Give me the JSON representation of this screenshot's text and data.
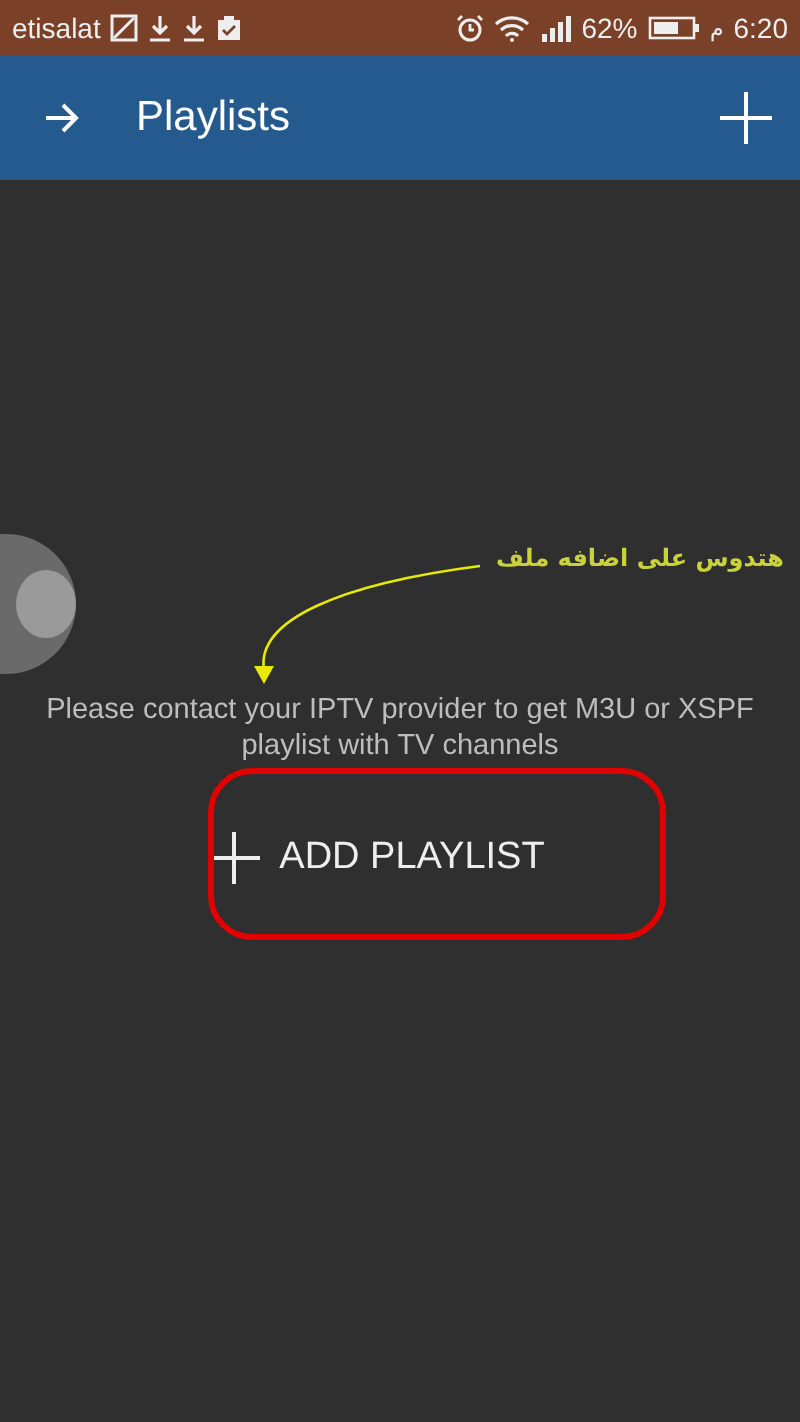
{
  "status_bar": {
    "carrier": "etisalat",
    "battery": "62%",
    "period": "م",
    "time": "6:20"
  },
  "app_bar": {
    "title": "Playlists"
  },
  "empty_state": {
    "message": "Please contact your IPTV provider to get M3U or XSPF playlist with TV channels",
    "button": "ADD PLAYLIST"
  },
  "annotation": {
    "text": "هتدوس على اضافه ملف"
  }
}
